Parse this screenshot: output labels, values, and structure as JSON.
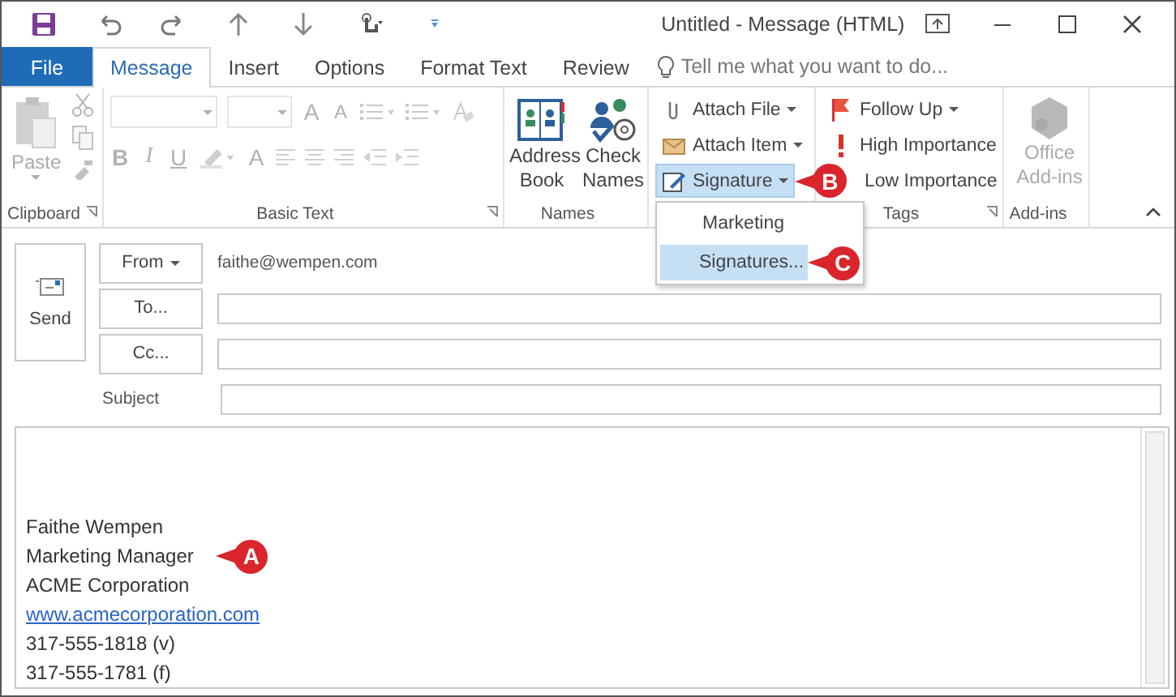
{
  "window": {
    "title": "Untitled - Message (HTML)"
  },
  "tabs": [
    {
      "label": "File",
      "kind": "file",
      "selected": false
    },
    {
      "label": "Message",
      "kind": "tab",
      "selected": true
    },
    {
      "label": "Insert",
      "kind": "tab",
      "selected": false
    },
    {
      "label": "Options",
      "kind": "tab",
      "selected": false
    },
    {
      "label": "Format Text",
      "kind": "tab",
      "selected": false
    },
    {
      "label": "Review",
      "kind": "tab",
      "selected": false
    }
  ],
  "tell_me": {
    "placeholder": "Tell me what you want to do..."
  },
  "ribbon": {
    "clipboard": {
      "label": "Clipboard",
      "paste": "Paste",
      "disabled": true
    },
    "basic_text": {
      "label": "Basic Text",
      "disabled": true,
      "grow_font": "A",
      "shrink_font": "A",
      "bold": "B",
      "italic": "I",
      "underline": "U",
      "font_color": "A"
    },
    "names": {
      "label": "Names",
      "buttons": [
        "Address Book",
        "Check Names"
      ]
    },
    "include": {
      "buttons": [
        {
          "label": "Attach File",
          "kind": "attach-file",
          "selected": false
        },
        {
          "label": "Attach Item",
          "kind": "attach-item",
          "selected": false
        },
        {
          "label": "Signature",
          "kind": "signature",
          "selected": true,
          "callout": "B"
        }
      ]
    },
    "tags": {
      "label": "Tags",
      "buttons": [
        {
          "label": "Follow Up",
          "kind": "flag",
          "dropdown": true
        },
        {
          "label": "High Importance",
          "kind": "high",
          "dropdown": false
        },
        {
          "label": "Low Importance",
          "kind": "low",
          "dropdown": false
        }
      ]
    },
    "addins": {
      "label": "Add-ins",
      "button": "Office Add-ins",
      "disabled": true
    }
  },
  "signature_menu": {
    "items": [
      {
        "label": "Marketing",
        "selected": false
      },
      {
        "label": "Signatures...",
        "selected": true,
        "callout": "C"
      }
    ]
  },
  "compose": {
    "send": "Send",
    "from_button": "From",
    "from_value": "faithe@wempen.com",
    "to_button": "To...",
    "cc_button": "Cc...",
    "subject_label": "Subject"
  },
  "body": {
    "lines": [
      {
        "text": "Faithe Wempen",
        "kind": "text"
      },
      {
        "text": "Marketing Manager",
        "kind": "text",
        "callout": "A"
      },
      {
        "text": "ACME Corporation",
        "kind": "text"
      },
      {
        "text": "www.acmecorporation.com",
        "kind": "link"
      },
      {
        "text": "317-555-1818 (v)",
        "kind": "text"
      },
      {
        "text": "317-555-1781 (f)",
        "kind": "text"
      }
    ]
  }
}
